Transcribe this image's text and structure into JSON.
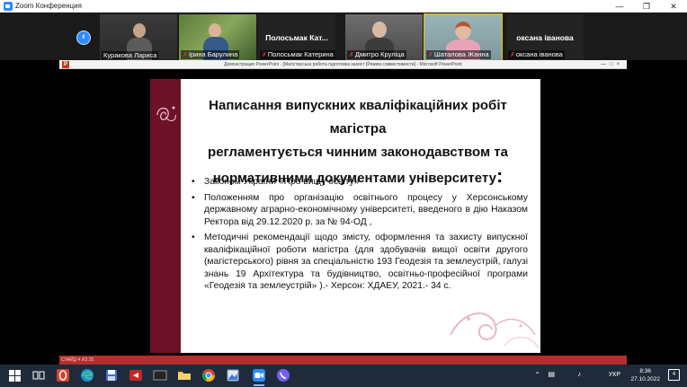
{
  "window": {
    "title": "Zoom Конференция",
    "controls": [
      "—",
      "❐",
      "✕"
    ]
  },
  "gallery": {
    "participants": [
      {
        "name": "Куракова Лариса",
        "muted": false,
        "video": true
      },
      {
        "name": "Ірина Барулина",
        "muted": true,
        "video": true
      },
      {
        "name": "Полосьмак Катерина",
        "muted": true,
        "video": false,
        "display_name": "Полосьмак  Кат..."
      },
      {
        "name": "Дмитро Круліца",
        "muted": true,
        "video": true
      },
      {
        "name": "Шаталова Жанна",
        "muted": true,
        "video": true,
        "active": true
      },
      {
        "name": "оксана іванова",
        "muted": true,
        "video": false,
        "display_name": "оксана іванова"
      }
    ]
  },
  "ppt": {
    "window_title": "Демонстрация PowerPoint - [Магістерська робота підготовка захист [Режим совместимости] - Microsoft PowerPoint",
    "status": "СЛАЙД 4 ИЗ 25",
    "slide": {
      "title_lines": [
        "Написання випускних кваліфікаційних робіт магістра",
        "регламентується чинним законодавством та",
        "нормативними документами університету"
      ],
      "title_colon": ":",
      "bullets": [
        "Законом України «Про вищу освіту»",
        "Положенням про організацію освітнього процесу у Херсонському державному аграрно-економічному університеті,  введеного в дію Наказом Ректора від 29.12.2020 р. за № 94-ОД ,",
        "Методичні рекомендації щодо змісту, оформлення та захисту випускної кваліфікаційної роботи магістра (для здобувачів вищої освіти другого (магістерського) рівня за спеціальністю    193 Геодезія та землеустрій, галузі знань   19 Архітектура та будівництво, освітньо-професійної програми   «Геодезія та землеустрій» ).- Херсон: ХДАЕУ, 2021.- 34 с."
      ]
    }
  },
  "taskbar": {
    "language": "УКР",
    "time": "8:36",
    "date": "27.10.2022",
    "notifications": "4"
  },
  "colors": {
    "zoom_blue": "#2d8cff",
    "slide_band": "#6c1129",
    "status_bar": "#b32e2e",
    "taskbar": "#1f2b3a"
  }
}
